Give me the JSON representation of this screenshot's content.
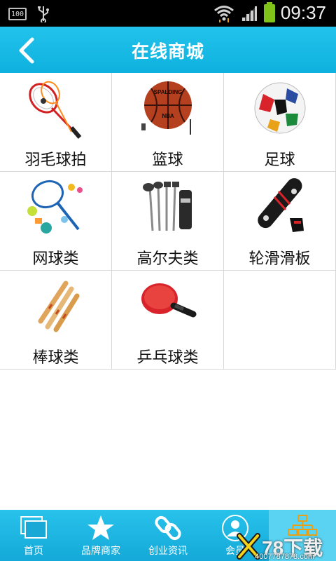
{
  "status_bar": {
    "battery_percent_label": "100",
    "time": "09:37",
    "icons": [
      "battery-100-icon",
      "usb-icon",
      "wifi-icon",
      "signal-icon",
      "battery-charging-icon"
    ],
    "battery_color": "#7fc31a"
  },
  "header": {
    "title": "在线商城",
    "back_icon": "chevron-left-icon",
    "background": "#1bb9e5"
  },
  "categories": [
    {
      "label": "羽毛球拍",
      "icon": "badminton-racket-image"
    },
    {
      "label": "篮球",
      "icon": "basketball-image"
    },
    {
      "label": "足球",
      "icon": "soccer-ball-image"
    },
    {
      "label": "网球类",
      "icon": "tennis-gear-image"
    },
    {
      "label": "高尔夫类",
      "icon": "golf-clubs-image"
    },
    {
      "label": "轮滑滑板",
      "icon": "skateboard-image"
    },
    {
      "label": "棒球类",
      "icon": "baseball-bats-image"
    },
    {
      "label": "乒乓球类",
      "icon": "table-tennis-paddle-image"
    }
  ],
  "bottom_nav": {
    "items": [
      {
        "label": "首页",
        "icon": "home-windows-icon"
      },
      {
        "label": "品牌商家",
        "icon": "star-icon"
      },
      {
        "label": "创业资讯",
        "icon": "link-icon"
      },
      {
        "label": "会员",
        "icon": "member-avatar-icon"
      },
      {
        "label": "",
        "icon": "sitemap-icon"
      }
    ]
  },
  "watermark": {
    "big": "78下载",
    "small": "4007787878.com"
  }
}
